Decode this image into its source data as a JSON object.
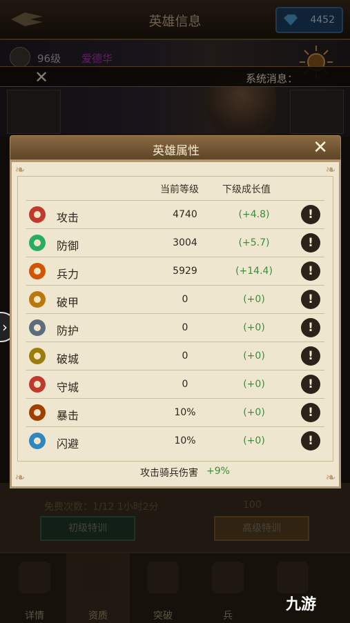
{
  "topbar": {
    "title": "英雄信息",
    "gems": "4452"
  },
  "hero": {
    "level": "96级",
    "name": "爱德华"
  },
  "system_bar": {
    "text": "系统消息："
  },
  "modal": {
    "title": "英雄属性",
    "columns": [
      "当前等级",
      "下级成长值"
    ],
    "stats": [
      {
        "name": "攻击",
        "current": "4740",
        "growth": "(+4.8)",
        "icon": "sword-icon",
        "color": "#c0392b"
      },
      {
        "name": "防御",
        "current": "3004",
        "growth": "(+5.7)",
        "icon": "shield-icon",
        "color": "#27ae60"
      },
      {
        "name": "兵力",
        "current": "5929",
        "growth": "(+14.4)",
        "icon": "troops-icon",
        "color": "#d35400"
      },
      {
        "name": "破甲",
        "current": "0",
        "growth": "(+0)",
        "icon": "armor-break-icon",
        "color": "#b9770e"
      },
      {
        "name": "防护",
        "current": "0",
        "growth": "(+0)",
        "icon": "protection-icon",
        "color": "#5d6d7e"
      },
      {
        "name": "破城",
        "current": "0",
        "growth": "(+0)",
        "icon": "siege-icon",
        "color": "#9a7d0a"
      },
      {
        "name": "守城",
        "current": "0",
        "growth": "(+0)",
        "icon": "castle-defense-icon",
        "color": "#c0392b"
      },
      {
        "name": "暴击",
        "current": "10%",
        "growth": "(+0)",
        "icon": "critical-icon",
        "color": "#a04000"
      },
      {
        "name": "闪避",
        "current": "10%",
        "growth": "(+0)",
        "icon": "dodge-icon",
        "color": "#2e86c1"
      }
    ],
    "footer": {
      "label": "攻击骑兵伤害",
      "value": "+9%"
    }
  },
  "lower": {
    "free_times": "免费次数：1/12   1小时2分",
    "gem_cost": "100",
    "btn_basic": "初级特训",
    "btn_advanced": "高级特训"
  },
  "bottom_nav": [
    "详情",
    "资质",
    "突破",
    "兵"
  ],
  "watermark": "九游"
}
